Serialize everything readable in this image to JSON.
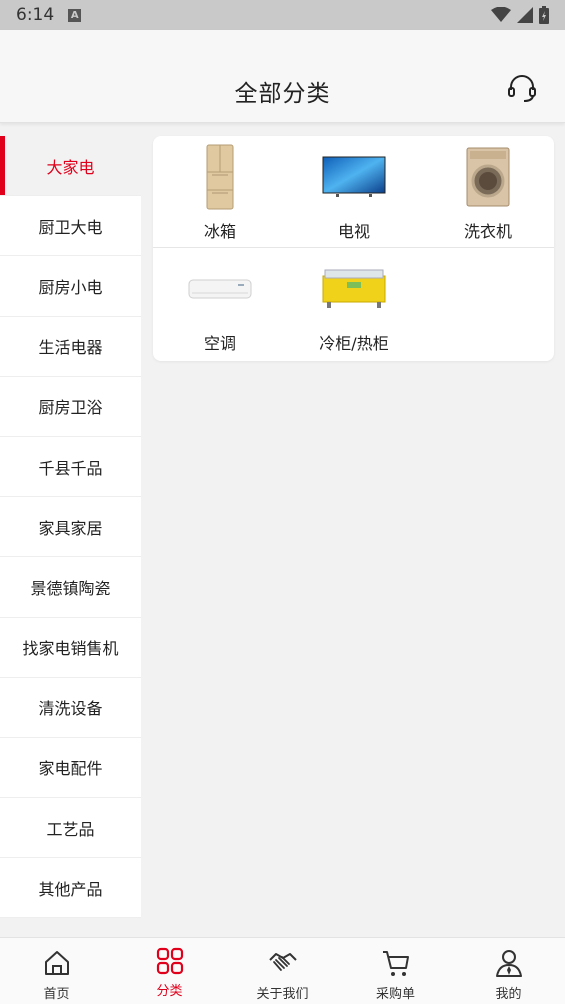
{
  "status_bar": {
    "time": "6:14",
    "notification_icon": "A"
  },
  "header": {
    "title": "全部分类",
    "support_icon": "headset-icon"
  },
  "sidebar": {
    "items": [
      {
        "label": "大家电",
        "active": true
      },
      {
        "label": "厨卫大电",
        "active": false
      },
      {
        "label": "厨房小电",
        "active": false
      },
      {
        "label": "生活电器",
        "active": false
      },
      {
        "label": "厨房卫浴",
        "active": false
      },
      {
        "label": "千县千品",
        "active": false
      },
      {
        "label": "家具家居",
        "active": false
      },
      {
        "label": "景德镇陶瓷",
        "active": false
      },
      {
        "label": "找家电销售机",
        "active": false
      },
      {
        "label": "清洗设备",
        "active": false
      },
      {
        "label": "家电配件",
        "active": false
      },
      {
        "label": "工艺品",
        "active": false
      },
      {
        "label": "其他产品",
        "active": false
      }
    ]
  },
  "categories": [
    {
      "label": "冰箱",
      "icon": "refrigerator-image"
    },
    {
      "label": "电视",
      "icon": "tv-image"
    },
    {
      "label": "洗衣机",
      "icon": "washing-machine-image"
    },
    {
      "label": "空调",
      "icon": "air-conditioner-image"
    },
    {
      "label": "冷柜/热柜",
      "icon": "freezer-image"
    }
  ],
  "bottom_nav": [
    {
      "label": "首页",
      "icon": "home-icon",
      "active": false
    },
    {
      "label": "分类",
      "icon": "category-icon",
      "active": true
    },
    {
      "label": "关于我们",
      "icon": "handshake-icon",
      "active": false
    },
    {
      "label": "采购单",
      "icon": "cart-icon",
      "active": false
    },
    {
      "label": "我的",
      "icon": "user-icon",
      "active": false
    }
  ],
  "colors": {
    "accent": "#e0001b",
    "background": "#f3f2f3",
    "status_bar": "#c9c9c9"
  }
}
